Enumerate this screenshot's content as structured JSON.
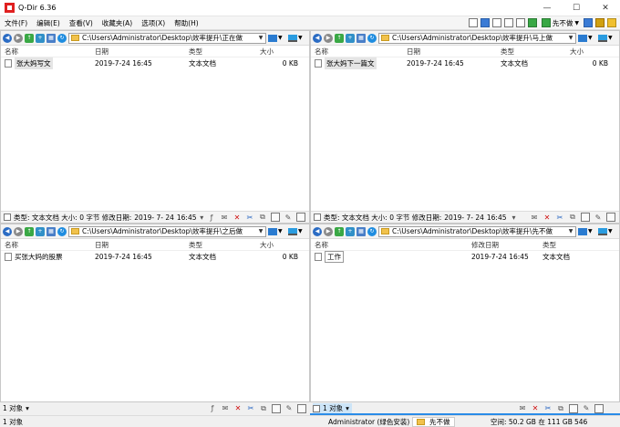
{
  "window": {
    "title": "Q-Dir 6.36",
    "minimize": "—",
    "maximize": "☐",
    "close": "✕"
  },
  "menu": {
    "items": [
      "文件(F)",
      "编辑(E)",
      "查看(V)",
      "收藏夹(A)",
      "选项(X)",
      "帮助(H)"
    ],
    "right_label": "先不做"
  },
  "columns": {
    "name": "名称",
    "date": "日期",
    "type": "类型",
    "size": "大小",
    "modified": "修改日期"
  },
  "panes": [
    {
      "path": "C:\\Users\\Administrator\\Desktop\\效率提升\\正在做",
      "rows": [
        {
          "name": "张大妈写文",
          "date": "2019-7-24 16:45",
          "type": "文本文档",
          "size": "0 KB"
        }
      ],
      "status": {
        "info": "类型: 文本文档 大小: 0 字节 修改日期: ",
        "date": "2019- 7- 24",
        "time": "16:45"
      }
    },
    {
      "path": "C:\\Users\\Administrator\\Desktop\\效率提升\\马上做",
      "rows": [
        {
          "name": "张大妈下一篇文",
          "date": "2019-7-24 16:45",
          "type": "文本文档",
          "size": "0 KB"
        }
      ],
      "status": {
        "info": "类型: 文本文档 大小: 0 字节 修改日期: ",
        "date": "2019- 7- 24",
        "time": "16:45"
      }
    },
    {
      "path": "C:\\Users\\Administrator\\Desktop\\效率提升\\之后做",
      "rows": [
        {
          "name": "买张大妈的股票",
          "date": "2019-7-24 16:45",
          "type": "文本文档",
          "size": "0 KB"
        }
      ],
      "count": "1 对象"
    },
    {
      "path": "C:\\Users\\Administrator\\Desktop\\效率提升\\先不做",
      "rows": [
        {
          "name": "工作",
          "date": "2019-7-24 16:45",
          "type": "文本文档"
        }
      ],
      "count": "1 对象"
    }
  ],
  "footer": {
    "count": "1 对象",
    "user": "Administrator (绿色安装)",
    "folder": "先不做",
    "space": "空间: 50.2 GB 在 111 GB",
    "number": "546"
  },
  "colors": {
    "accent": "#2a8ce8",
    "folder": "#f1c24c",
    "delete": "#d01010"
  }
}
